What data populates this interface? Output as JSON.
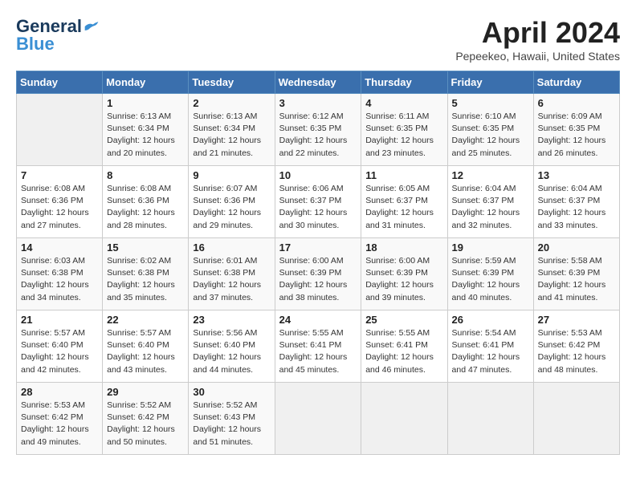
{
  "logo": {
    "line1": "General",
    "line2": "Blue"
  },
  "title": "April 2024",
  "subtitle": "Pepeekeo, Hawaii, United States",
  "weekdays": [
    "Sunday",
    "Monday",
    "Tuesday",
    "Wednesday",
    "Thursday",
    "Friday",
    "Saturday"
  ],
  "weeks": [
    [
      {
        "day": "",
        "info": ""
      },
      {
        "day": "1",
        "info": "Sunrise: 6:13 AM\nSunset: 6:34 PM\nDaylight: 12 hours\nand 20 minutes."
      },
      {
        "day": "2",
        "info": "Sunrise: 6:13 AM\nSunset: 6:34 PM\nDaylight: 12 hours\nand 21 minutes."
      },
      {
        "day": "3",
        "info": "Sunrise: 6:12 AM\nSunset: 6:35 PM\nDaylight: 12 hours\nand 22 minutes."
      },
      {
        "day": "4",
        "info": "Sunrise: 6:11 AM\nSunset: 6:35 PM\nDaylight: 12 hours\nand 23 minutes."
      },
      {
        "day": "5",
        "info": "Sunrise: 6:10 AM\nSunset: 6:35 PM\nDaylight: 12 hours\nand 25 minutes."
      },
      {
        "day": "6",
        "info": "Sunrise: 6:09 AM\nSunset: 6:35 PM\nDaylight: 12 hours\nand 26 minutes."
      }
    ],
    [
      {
        "day": "7",
        "info": "Sunrise: 6:08 AM\nSunset: 6:36 PM\nDaylight: 12 hours\nand 27 minutes."
      },
      {
        "day": "8",
        "info": "Sunrise: 6:08 AM\nSunset: 6:36 PM\nDaylight: 12 hours\nand 28 minutes."
      },
      {
        "day": "9",
        "info": "Sunrise: 6:07 AM\nSunset: 6:36 PM\nDaylight: 12 hours\nand 29 minutes."
      },
      {
        "day": "10",
        "info": "Sunrise: 6:06 AM\nSunset: 6:37 PM\nDaylight: 12 hours\nand 30 minutes."
      },
      {
        "day": "11",
        "info": "Sunrise: 6:05 AM\nSunset: 6:37 PM\nDaylight: 12 hours\nand 31 minutes."
      },
      {
        "day": "12",
        "info": "Sunrise: 6:04 AM\nSunset: 6:37 PM\nDaylight: 12 hours\nand 32 minutes."
      },
      {
        "day": "13",
        "info": "Sunrise: 6:04 AM\nSunset: 6:37 PM\nDaylight: 12 hours\nand 33 minutes."
      }
    ],
    [
      {
        "day": "14",
        "info": "Sunrise: 6:03 AM\nSunset: 6:38 PM\nDaylight: 12 hours\nand 34 minutes."
      },
      {
        "day": "15",
        "info": "Sunrise: 6:02 AM\nSunset: 6:38 PM\nDaylight: 12 hours\nand 35 minutes."
      },
      {
        "day": "16",
        "info": "Sunrise: 6:01 AM\nSunset: 6:38 PM\nDaylight: 12 hours\nand 37 minutes."
      },
      {
        "day": "17",
        "info": "Sunrise: 6:00 AM\nSunset: 6:39 PM\nDaylight: 12 hours\nand 38 minutes."
      },
      {
        "day": "18",
        "info": "Sunrise: 6:00 AM\nSunset: 6:39 PM\nDaylight: 12 hours\nand 39 minutes."
      },
      {
        "day": "19",
        "info": "Sunrise: 5:59 AM\nSunset: 6:39 PM\nDaylight: 12 hours\nand 40 minutes."
      },
      {
        "day": "20",
        "info": "Sunrise: 5:58 AM\nSunset: 6:39 PM\nDaylight: 12 hours\nand 41 minutes."
      }
    ],
    [
      {
        "day": "21",
        "info": "Sunrise: 5:57 AM\nSunset: 6:40 PM\nDaylight: 12 hours\nand 42 minutes."
      },
      {
        "day": "22",
        "info": "Sunrise: 5:57 AM\nSunset: 6:40 PM\nDaylight: 12 hours\nand 43 minutes."
      },
      {
        "day": "23",
        "info": "Sunrise: 5:56 AM\nSunset: 6:40 PM\nDaylight: 12 hours\nand 44 minutes."
      },
      {
        "day": "24",
        "info": "Sunrise: 5:55 AM\nSunset: 6:41 PM\nDaylight: 12 hours\nand 45 minutes."
      },
      {
        "day": "25",
        "info": "Sunrise: 5:55 AM\nSunset: 6:41 PM\nDaylight: 12 hours\nand 46 minutes."
      },
      {
        "day": "26",
        "info": "Sunrise: 5:54 AM\nSunset: 6:41 PM\nDaylight: 12 hours\nand 47 minutes."
      },
      {
        "day": "27",
        "info": "Sunrise: 5:53 AM\nSunset: 6:42 PM\nDaylight: 12 hours\nand 48 minutes."
      }
    ],
    [
      {
        "day": "28",
        "info": "Sunrise: 5:53 AM\nSunset: 6:42 PM\nDaylight: 12 hours\nand 49 minutes."
      },
      {
        "day": "29",
        "info": "Sunrise: 5:52 AM\nSunset: 6:42 PM\nDaylight: 12 hours\nand 50 minutes."
      },
      {
        "day": "30",
        "info": "Sunrise: 5:52 AM\nSunset: 6:43 PM\nDaylight: 12 hours\nand 51 minutes."
      },
      {
        "day": "",
        "info": ""
      },
      {
        "day": "",
        "info": ""
      },
      {
        "day": "",
        "info": ""
      },
      {
        "day": "",
        "info": ""
      }
    ]
  ]
}
